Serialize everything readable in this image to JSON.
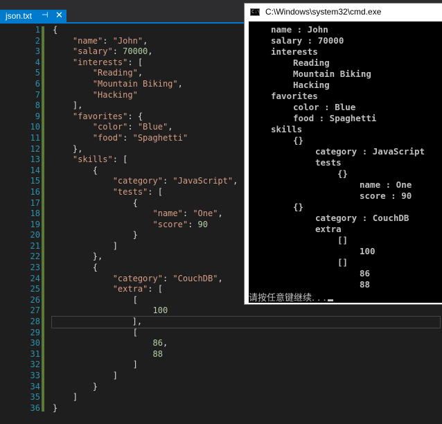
{
  "editor": {
    "tab": {
      "file_name": "json.txt",
      "pin_glyph": "⊣",
      "close_glyph": "✕"
    },
    "lines": [
      {
        "n": "1",
        "ind": 0,
        "t": [
          [
            "p",
            "{"
          ]
        ]
      },
      {
        "n": "2",
        "ind": 1,
        "t": [
          [
            "s",
            "\"name\""
          ],
          [
            "p",
            ": "
          ],
          [
            "s",
            "\"John\""
          ],
          [
            "p",
            ","
          ]
        ]
      },
      {
        "n": "3",
        "ind": 1,
        "t": [
          [
            "s",
            "\"salary\""
          ],
          [
            "p",
            ": "
          ],
          [
            "n",
            "70000"
          ],
          [
            "p",
            ","
          ]
        ]
      },
      {
        "n": "4",
        "ind": 1,
        "t": [
          [
            "s",
            "\"interests\""
          ],
          [
            "p",
            ": ["
          ]
        ]
      },
      {
        "n": "5",
        "ind": 2,
        "t": [
          [
            "s",
            "\"Reading\""
          ],
          [
            "p",
            ","
          ]
        ]
      },
      {
        "n": "6",
        "ind": 2,
        "t": [
          [
            "s",
            "\"Mountain Biking\""
          ],
          [
            "p",
            ","
          ]
        ]
      },
      {
        "n": "7",
        "ind": 2,
        "t": [
          [
            "s",
            "\"Hacking\""
          ]
        ]
      },
      {
        "n": "8",
        "ind": 1,
        "t": [
          [
            "p",
            "],"
          ]
        ]
      },
      {
        "n": "9",
        "ind": 1,
        "t": [
          [
            "s",
            "\"favorites\""
          ],
          [
            "p",
            ": {"
          ]
        ]
      },
      {
        "n": "10",
        "ind": 2,
        "t": [
          [
            "s",
            "\"color\""
          ],
          [
            "p",
            ": "
          ],
          [
            "s",
            "\"Blue\""
          ],
          [
            "p",
            ","
          ]
        ]
      },
      {
        "n": "11",
        "ind": 2,
        "t": [
          [
            "s",
            "\"food\""
          ],
          [
            "p",
            ": "
          ],
          [
            "s",
            "\"Spaghetti\""
          ]
        ]
      },
      {
        "n": "12",
        "ind": 1,
        "t": [
          [
            "p",
            "},"
          ]
        ]
      },
      {
        "n": "13",
        "ind": 1,
        "t": [
          [
            "s",
            "\"skills\""
          ],
          [
            "p",
            ": ["
          ]
        ]
      },
      {
        "n": "14",
        "ind": 2,
        "t": [
          [
            "p",
            "{"
          ]
        ]
      },
      {
        "n": "15",
        "ind": 3,
        "t": [
          [
            "s",
            "\"category\""
          ],
          [
            "p",
            ": "
          ],
          [
            "s",
            "\"JavaScript\""
          ],
          [
            "p",
            ","
          ]
        ]
      },
      {
        "n": "16",
        "ind": 3,
        "t": [
          [
            "s",
            "\"tests\""
          ],
          [
            "p",
            ": ["
          ]
        ]
      },
      {
        "n": "17",
        "ind": 4,
        "t": [
          [
            "p",
            "{"
          ]
        ]
      },
      {
        "n": "18",
        "ind": 5,
        "t": [
          [
            "s",
            "\"name\""
          ],
          [
            "p",
            ": "
          ],
          [
            "s",
            "\"One\""
          ],
          [
            "p",
            ","
          ]
        ]
      },
      {
        "n": "19",
        "ind": 5,
        "t": [
          [
            "s",
            "\"score\""
          ],
          [
            "p",
            ": "
          ],
          [
            "n",
            "90"
          ]
        ]
      },
      {
        "n": "20",
        "ind": 4,
        "t": [
          [
            "p",
            "}"
          ]
        ]
      },
      {
        "n": "21",
        "ind": 3,
        "t": [
          [
            "p",
            "]"
          ]
        ]
      },
      {
        "n": "22",
        "ind": 2,
        "t": [
          [
            "p",
            "},"
          ]
        ]
      },
      {
        "n": "23",
        "ind": 2,
        "t": [
          [
            "p",
            "{"
          ]
        ]
      },
      {
        "n": "24",
        "ind": 3,
        "t": [
          [
            "s",
            "\"category\""
          ],
          [
            "p",
            ": "
          ],
          [
            "s",
            "\"CouchDB\""
          ],
          [
            "p",
            ","
          ]
        ]
      },
      {
        "n": "25",
        "ind": 3,
        "t": [
          [
            "s",
            "\"extra\""
          ],
          [
            "p",
            ": ["
          ]
        ]
      },
      {
        "n": "26",
        "ind": 4,
        "t": [
          [
            "p",
            "["
          ]
        ]
      },
      {
        "n": "27",
        "ind": 5,
        "t": [
          [
            "n",
            "100"
          ]
        ]
      },
      {
        "n": "28",
        "ind": 4,
        "t": [
          [
            "p",
            "],"
          ]
        ],
        "current": true
      },
      {
        "n": "29",
        "ind": 4,
        "t": [
          [
            "p",
            "["
          ]
        ]
      },
      {
        "n": "30",
        "ind": 5,
        "t": [
          [
            "n",
            "86"
          ],
          [
            "p",
            ","
          ]
        ]
      },
      {
        "n": "31",
        "ind": 5,
        "t": [
          [
            "n",
            "88"
          ]
        ]
      },
      {
        "n": "32",
        "ind": 4,
        "t": [
          [
            "p",
            "]"
          ]
        ]
      },
      {
        "n": "33",
        "ind": 3,
        "t": [
          [
            "p",
            "]"
          ]
        ]
      },
      {
        "n": "34",
        "ind": 2,
        "t": [
          [
            "p",
            "}"
          ]
        ]
      },
      {
        "n": "35",
        "ind": 1,
        "t": [
          [
            "p",
            "]"
          ]
        ]
      },
      {
        "n": "36",
        "ind": 0,
        "t": [
          [
            "p",
            "}"
          ]
        ]
      }
    ]
  },
  "cmd": {
    "icon_text": "C:\\",
    "title": "C:\\Windows\\system32\\cmd.exe",
    "output": [
      {
        "ind": 1,
        "text": "name : John"
      },
      {
        "ind": 1,
        "text": "salary : 70000"
      },
      {
        "ind": 1,
        "text": "interests"
      },
      {
        "ind": 2,
        "text": "Reading"
      },
      {
        "ind": 2,
        "text": "Mountain Biking"
      },
      {
        "ind": 2,
        "text": "Hacking"
      },
      {
        "ind": 1,
        "text": "favorites"
      },
      {
        "ind": 2,
        "text": "color : Blue"
      },
      {
        "ind": 2,
        "text": "food : Spaghetti"
      },
      {
        "ind": 1,
        "text": "skills"
      },
      {
        "ind": 2,
        "text": "{}"
      },
      {
        "ind": 3,
        "text": "category : JavaScript"
      },
      {
        "ind": 3,
        "text": "tests"
      },
      {
        "ind": 4,
        "text": "{}"
      },
      {
        "ind": 5,
        "text": "name : One"
      },
      {
        "ind": 5,
        "text": "score : 90"
      },
      {
        "ind": 2,
        "text": "{}"
      },
      {
        "ind": 3,
        "text": "category : CouchDB"
      },
      {
        "ind": 3,
        "text": "extra"
      },
      {
        "ind": 4,
        "text": "[]"
      },
      {
        "ind": 5,
        "text": "100"
      },
      {
        "ind": 4,
        "text": "[]"
      },
      {
        "ind": 5,
        "text": "86"
      },
      {
        "ind": 5,
        "text": "88"
      }
    ],
    "prompt": "请按任意键继续. . ."
  }
}
